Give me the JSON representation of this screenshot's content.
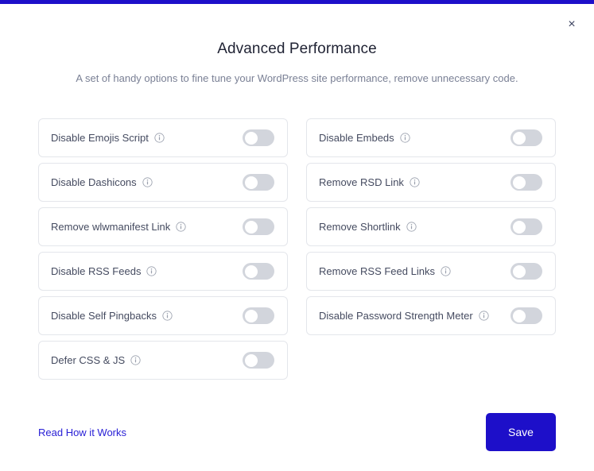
{
  "theme": {
    "accent": "#1d0fc9",
    "link": "#2a21d6",
    "toggle_off_track": "#d2d5dc",
    "card_border": "#e4e6eb",
    "title_color": "#1f2233",
    "subtitle_color": "#7a8095",
    "label_color": "#454b60"
  },
  "header": {
    "close_label": "×",
    "close_icon": "close-icon",
    "title": "Advanced Performance",
    "subtitle": "A set of handy options to fine tune your WordPress site performance, remove unnecessary code."
  },
  "options": {
    "info_icon": "info-circle-icon",
    "left_column": [
      {
        "label": "Disable Emojis Script",
        "enabled": false
      },
      {
        "label": "Disable Dashicons",
        "enabled": false
      },
      {
        "label": "Remove wlwmanifest Link",
        "enabled": false
      },
      {
        "label": "Disable RSS Feeds",
        "enabled": false
      },
      {
        "label": "Disable Self Pingbacks",
        "enabled": false
      },
      {
        "label": "Defer CSS & JS",
        "enabled": false
      }
    ],
    "right_column": [
      {
        "label": "Disable Embeds",
        "enabled": false
      },
      {
        "label": "Remove RSD Link",
        "enabled": false
      },
      {
        "label": "Remove Shortlink",
        "enabled": false
      },
      {
        "label": "Remove RSS Feed Links",
        "enabled": false
      },
      {
        "label": "Disable Password Strength Meter",
        "enabled": false
      }
    ]
  },
  "footer": {
    "link_label": "Read How it Works",
    "save_label": "Save"
  }
}
